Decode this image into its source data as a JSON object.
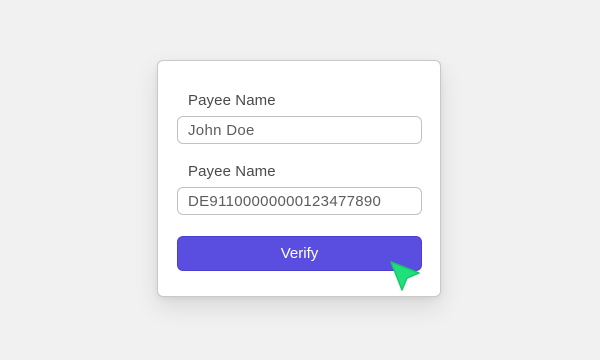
{
  "form": {
    "field1": {
      "label": "Payee Name",
      "value": "John Doe"
    },
    "field2": {
      "label": "Payee Name",
      "value": "DE91100000000123477890"
    },
    "verify_label": "Verify"
  },
  "cursor": {
    "icon": "pointer-arrow-icon",
    "color": "#1fe07a"
  },
  "colors": {
    "accent": "#5a4ee0",
    "background": "#f1f1f1"
  }
}
